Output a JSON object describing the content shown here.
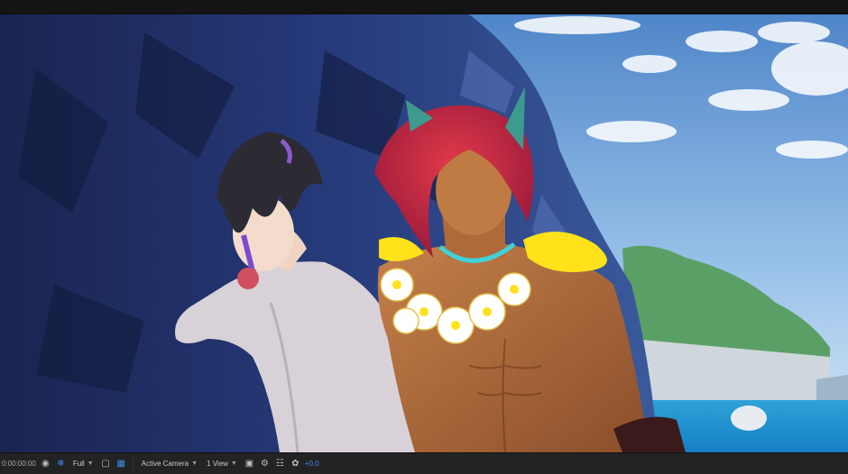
{
  "statusbar": {
    "timecode": "0:00:00:00",
    "resolution": "Full",
    "camera": "Active Camera",
    "views": "1 View",
    "exposure": "+0,0"
  },
  "icons": {
    "snapshot": "camera-icon",
    "color": "color-channels-icon",
    "region": "region-of-interest-icon",
    "transparency": "transparency-grid-icon",
    "layout": "view-layout-icon",
    "flowchart": "flowchart-icon",
    "reset_exposure": "exposure-icon"
  },
  "colors": {
    "accent": "#3f8ef0",
    "panel": "#232323"
  }
}
